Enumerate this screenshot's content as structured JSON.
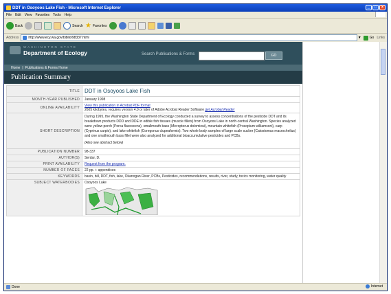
{
  "window": {
    "title": "DDT in Osoyoos Lake Fish - Microsoft Internet Explorer",
    "menu": [
      "File",
      "Edit",
      "View",
      "Favorites",
      "Tools",
      "Help"
    ]
  },
  "toolbar": {
    "back_label": "Back",
    "search_label": "Search",
    "favorites_label": "Favorites"
  },
  "addressbar": {
    "label": "Address",
    "url": "http://www.ecy.wa.gov/biblio/98337.html",
    "go_label": "Go",
    "links_label": "Links"
  },
  "site": {
    "agency_small": "WASHINGTON STATE",
    "agency_name": "Department of Ecology",
    "search_label": "Search Publications & Forms",
    "search_value": "",
    "go_label": "GO",
    "nav": [
      "Home",
      "|",
      "Publications & Forms Home"
    ],
    "page_heading": "Publication Summary"
  },
  "publication": {
    "rows": [
      {
        "label": "TITLE",
        "value": "DDT in Osoyoos Lake Fish"
      },
      {
        "label": "MONTH-YEAR PUBLISHED",
        "value": "January 1998"
      },
      {
        "label": "ONLINE AVAILABILITY",
        "link1": "View this publication in Acrobat PDF format",
        "text": "2605 kilobytes,  requires version 4.0 or later of Adobe Acrobat Reader Software",
        "link2": "get Acrobat Reader"
      },
      {
        "label": "SHORT DESCRIPTION",
        "value": "During 1995, the Washington State Department of Ecology conducted a survey to assess concentrations of the pesticide DDT and its breakdown products DDD and DDE in edible fish tissues (muscle fillets) from Osoyoos Lake in north-central Washington. Species analyzed were yellow perch (Perca flavescens), smallmouth bass (Micropterus dolomieui), mountain whitefish (Prosopium williamsoni), carp (Cyprinus carpio), and lake whitefish (Coregonus clupeaformis). Two whole body samples of large scale sucker (Catostomus macrocheilus) and one smallmouth bass fillet were also analyzed for additional bioaccumulative pesticides and PCBs.",
        "note": "(Also see abstract below)"
      },
      {
        "label": "PUBLICATION NUMBER",
        "value": "98-337"
      },
      {
        "label": "AUTHOR(S)",
        "value": "Serdar, D."
      },
      {
        "label": "PRINT AVAILABILITY",
        "value": "Request from the program."
      },
      {
        "label": "NUMBER OF PAGES",
        "value": "22 pp. + appendices"
      },
      {
        "label": "KEYWORDS",
        "value": "basin, bill, DDT, fish, lake, Okanogan River, PCBs, Pesticides, recommendations, results, river, study, toxics monitoring, water quality"
      },
      {
        "label": "SUBJECT WATERBODIES",
        "value": "Osoyoos Lake"
      }
    ]
  },
  "status": {
    "left": "Done",
    "zone": "Internet"
  }
}
